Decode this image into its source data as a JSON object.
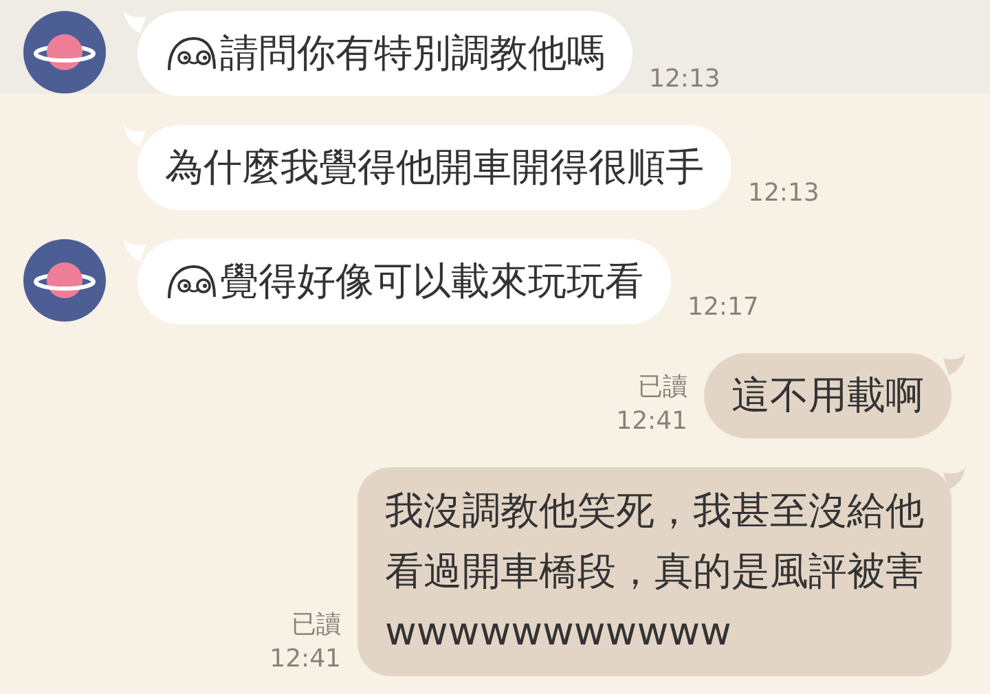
{
  "messages": [
    {
      "kind": "incoming",
      "avatar": true,
      "emoticon": true,
      "lines": [
        "請問你有特別調教他嗎"
      ],
      "time": "12:13"
    },
    {
      "kind": "incoming",
      "avatar": false,
      "emoticon": false,
      "lines": [
        "為什麼我覺得他開車開得很順手"
      ],
      "time": "12:13"
    },
    {
      "kind": "incoming",
      "avatar": true,
      "emoticon": true,
      "lines": [
        "覺得好像可以載來玩玩看"
      ],
      "time": "12:17"
    },
    {
      "kind": "outgoing",
      "read": "已讀",
      "lines": [
        "這不用載啊"
      ],
      "time": "12:41"
    },
    {
      "kind": "outgoing",
      "read": "已讀",
      "lines": [
        "我沒調教他笑死，我甚至沒給他",
        "看過開車橋段，真的是風評被害",
        "wwwwwwwwwww"
      ],
      "time": "12:41"
    }
  ]
}
